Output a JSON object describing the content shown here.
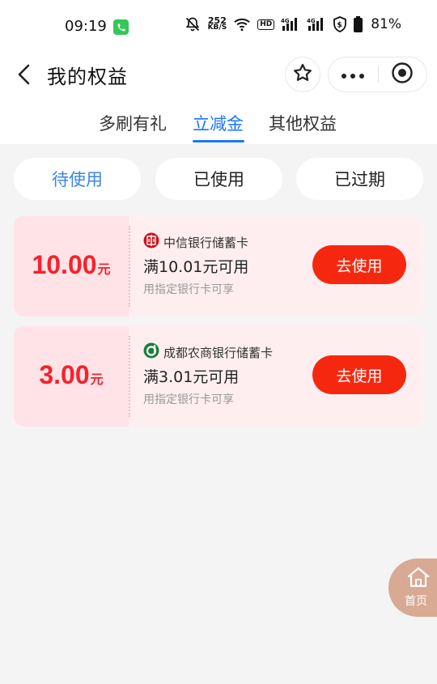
{
  "status_bar": {
    "time": "09:19",
    "net_speed_value": "252",
    "net_speed_unit": "KB/S",
    "hd_label": "HD",
    "signal1_label": "4G",
    "signal2_label": "4G",
    "battery_percent": "81%"
  },
  "header": {
    "title": "我的权益"
  },
  "tabs": [
    {
      "label": "多刷有礼"
    },
    {
      "label": "立减金",
      "active": true
    },
    {
      "label": "其他权益"
    }
  ],
  "filters": [
    {
      "label": "待使用",
      "active": true
    },
    {
      "label": "已使用"
    },
    {
      "label": "已过期"
    }
  ],
  "coupons": [
    {
      "amount": "10.00",
      "unit": "元",
      "bank": "中信银行储蓄卡",
      "condition": "满10.01元可用",
      "tip": "用指定银行卡可享",
      "button_label": "去使用"
    },
    {
      "amount": "3.00",
      "unit": "元",
      "bank": "成都农商银行储蓄卡",
      "condition": "满3.01元可用",
      "tip": "用指定银行卡可享",
      "button_label": "去使用"
    }
  ],
  "home_float": {
    "label": "首页"
  },
  "colors": {
    "accent_blue": "#1677ff",
    "coupon_red": "#f5222d",
    "use_button": "#f5280f",
    "coupon_bg": "#ffeef0",
    "home_float": "#d8a993",
    "citic_logo": "#d0121b",
    "chengdu_logo": "#1a7f3c"
  },
  "icons": {
    "back": "chevron-left-icon",
    "favorite": "star-icon",
    "more": "more-dots-icon",
    "close": "target-close-icon",
    "home": "home-icon"
  }
}
